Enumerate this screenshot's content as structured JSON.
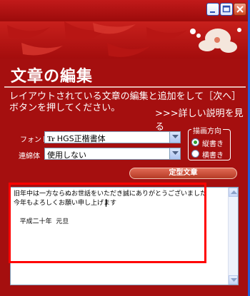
{
  "window": {
    "controls": [
      "minimize-icon",
      "maximize-icon",
      "close-icon"
    ]
  },
  "page": {
    "title": "文章の編集",
    "instruction": "レイアウトされている文章の編集と追加をして［次へ］ボタンを押してください。",
    "detail_link": ">>>詳しい説明を見る"
  },
  "form": {
    "font_label": "フォント",
    "font_value": "HGS正楷書体",
    "font_icon": "truetype-icon",
    "combine_label": "連綿体",
    "combine_value": "使用しない",
    "direction": {
      "legend": "描画方向",
      "options": [
        {
          "label": "縦書き",
          "selected": true
        },
        {
          "label": "横書き",
          "selected": false
        }
      ]
    },
    "template_button": "定型文章"
  },
  "editor": {
    "text": "旧年中は一方ならぬお世話をいただき誠にありがとうございました\n今年もよろしくお願い申し上げます\n\n   平成二十年  元旦"
  },
  "colors": {
    "background": "#a50f0f",
    "highlight": "#ff0000",
    "button": "#c94a35"
  }
}
